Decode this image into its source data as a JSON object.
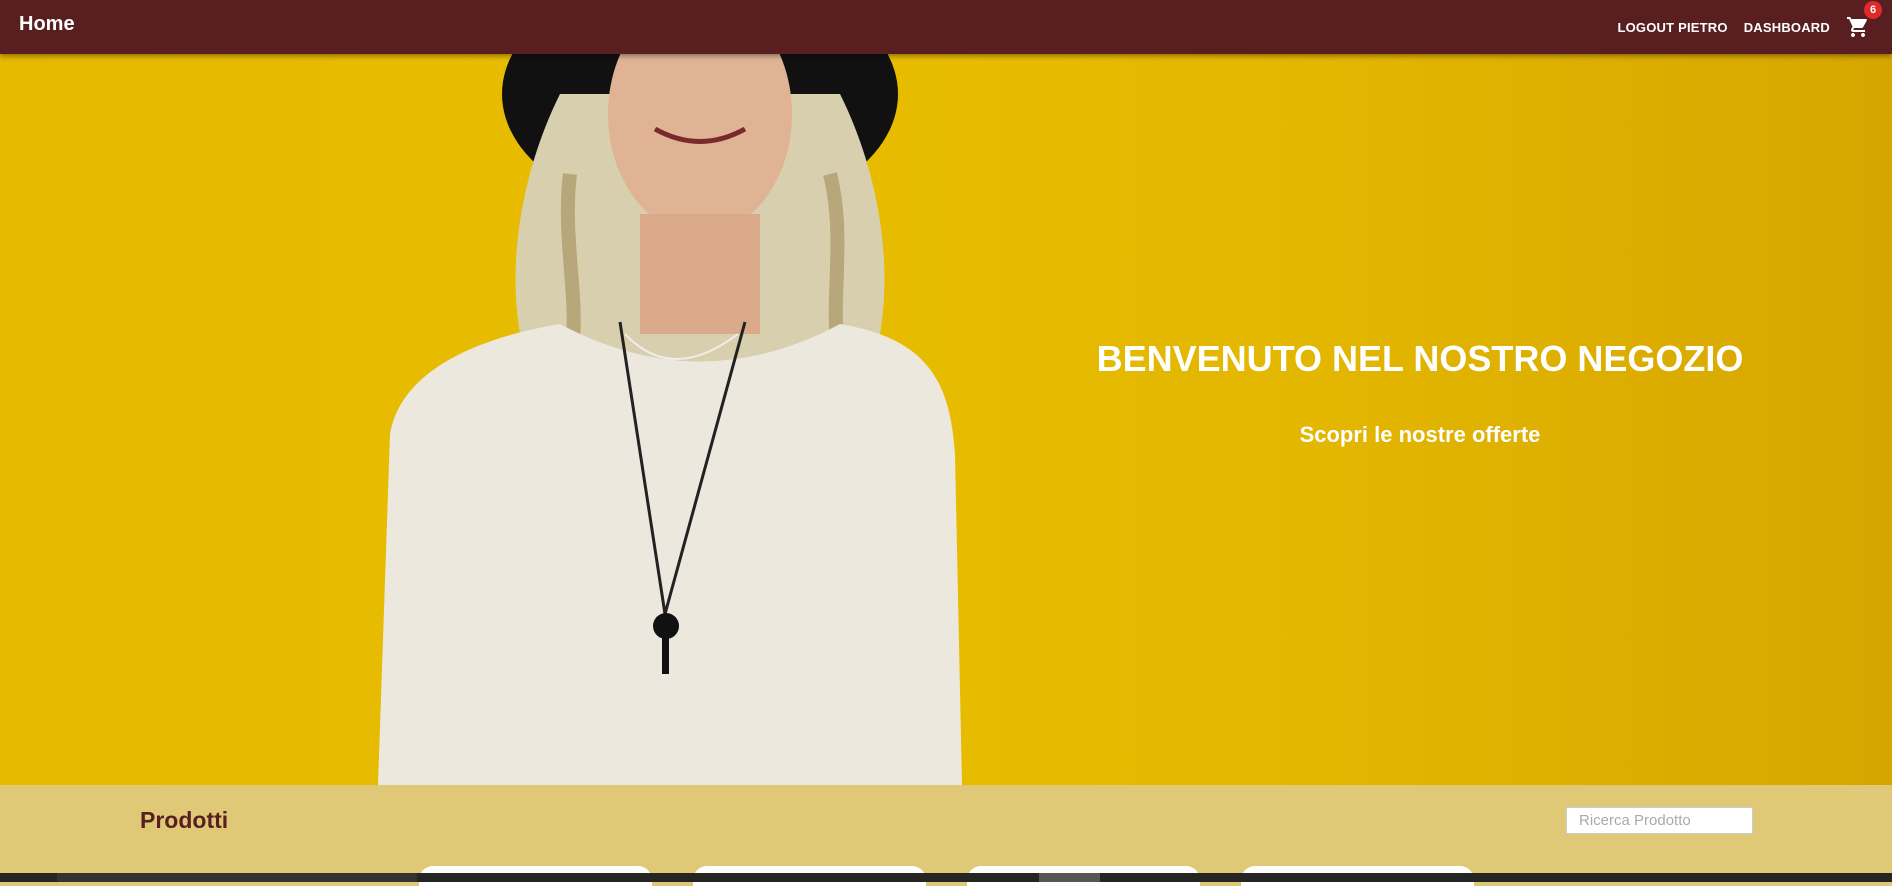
{
  "nav": {
    "brand": "Home",
    "logout_label": "LOGOUT PIETRO",
    "dashboard_label": "DASHBOARD",
    "cart_icon": "shopping-cart-icon",
    "cart_count": "6",
    "background": "#591f20"
  },
  "hero": {
    "title": "BENVENUTO NEL NOSTRO NEGOZIO",
    "subtitle": "Scopri le nostre offerte",
    "background": "#e6b800"
  },
  "products": {
    "title": "Prodotti",
    "search_placeholder": "Ricerca Prodotto",
    "search_value": "",
    "background": "#dfc977"
  }
}
